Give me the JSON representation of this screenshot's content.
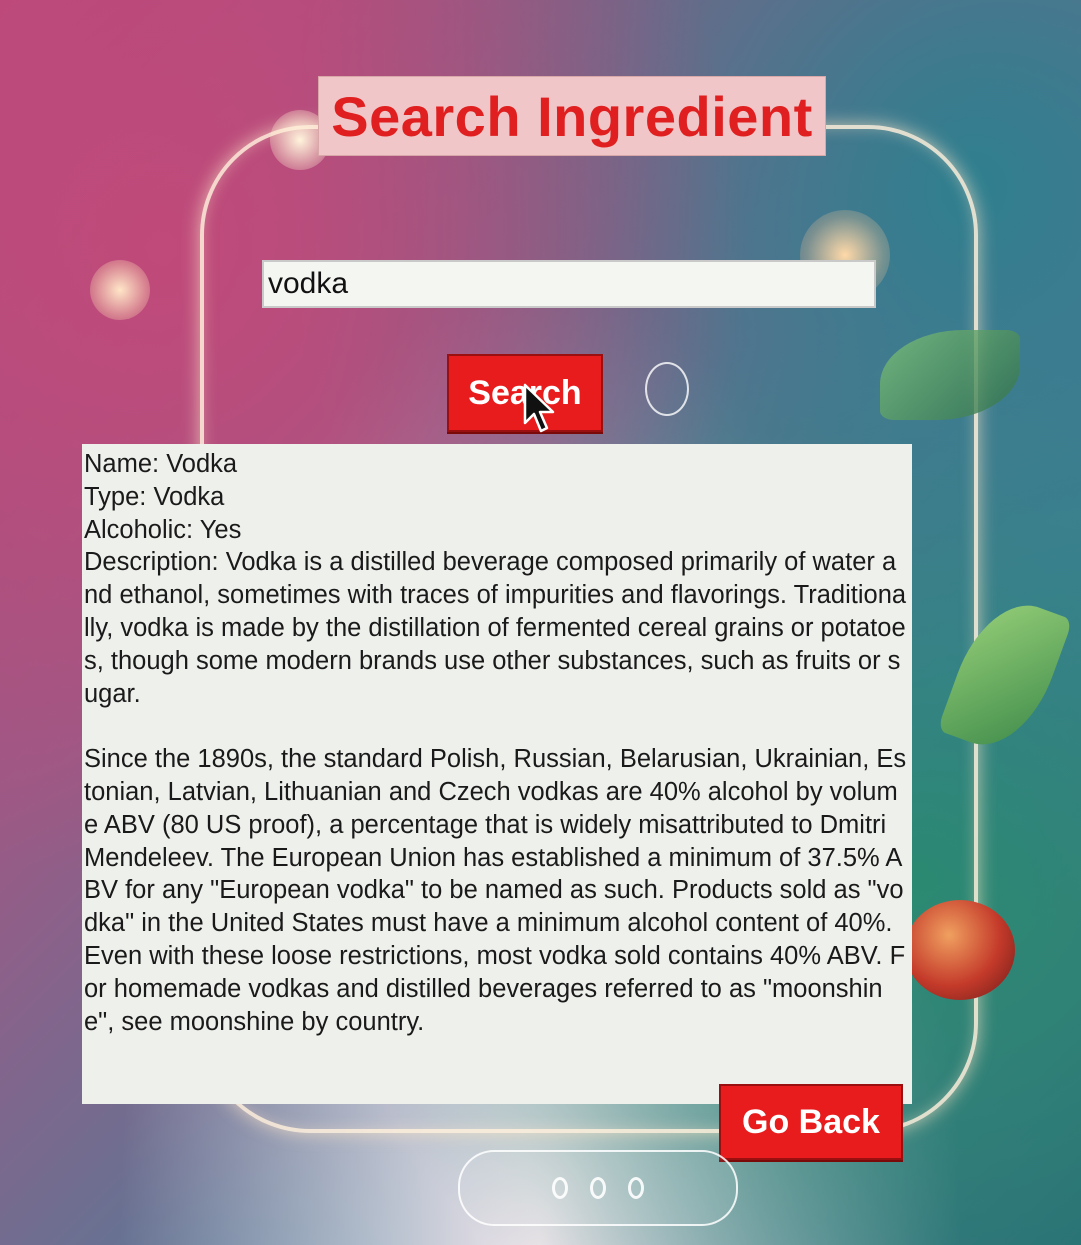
{
  "header": {
    "title": "Search Ingredient"
  },
  "search": {
    "value": "vodka",
    "button_label": "Search"
  },
  "result": {
    "name": "Name: Vodka",
    "type": "Type: Vodka",
    "alcoholic": "Alcoholic: Yes",
    "description_p1": "Description: Vodka is a distilled beverage composed primarily of water and ethanol, sometimes with traces of impurities and flavorings. Traditionally, vodka is made by the distillation of fermented cereal grains or potatoes, though some modern brands use other substances, such as fruits or sugar.",
    "description_p2": "Since the 1890s, the standard Polish, Russian, Belarusian, Ukrainian, Estonian, Latvian, Lithuanian and Czech vodkas are 40% alcohol by volume ABV (80 US proof), a percentage that is widely misattributed to Dmitri Mendeleev. The European Union has established a minimum of 37.5% ABV for any \"European vodka\" to be named as such. Products sold as \"vodka\" in the United States must have a minimum alcohol content of 40%. Even with these loose restrictions, most vodka sold contains 40% ABV. For homemade vodkas and distilled beverages referred to as \"moonshine\", see moonshine by country."
  },
  "footer": {
    "back_label": "Go Back"
  },
  "colors": {
    "accent_red": "#e81c1c",
    "title_bg": "#f0c6c8"
  }
}
